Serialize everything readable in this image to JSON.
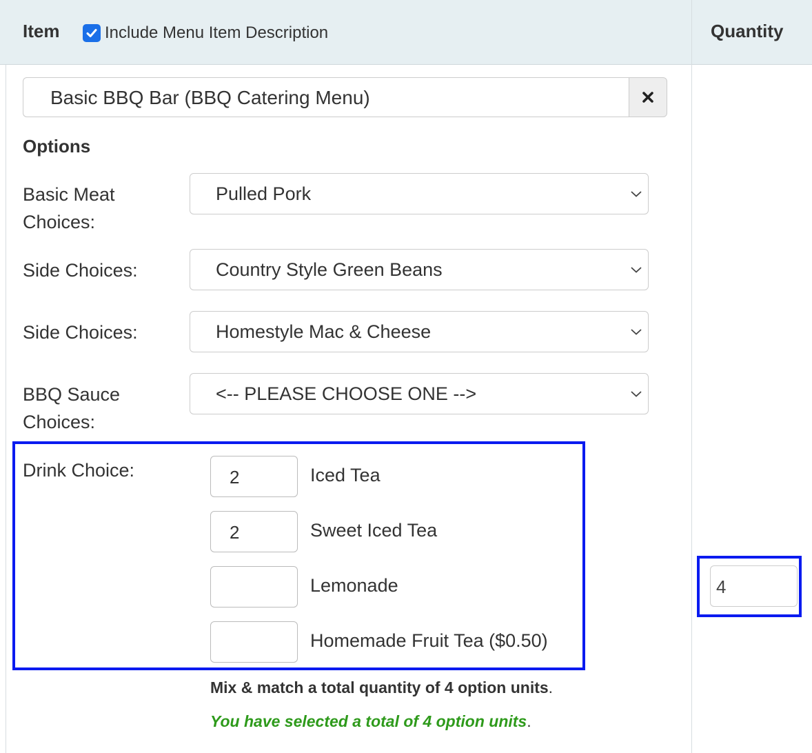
{
  "header": {
    "item_label": "Item",
    "include_description_label": "Include Menu Item Description",
    "include_description_checked": true,
    "quantity_label": "Quantity"
  },
  "item": {
    "selected": "Basic BBQ Bar (BBQ Catering Menu)"
  },
  "options": {
    "heading": "Options",
    "selects": [
      {
        "label": "Basic Meat Choices:",
        "value": "Pulled Pork"
      },
      {
        "label": "Side Choices:",
        "value": "Country Style Green Beans"
      },
      {
        "label": "Side Choices:",
        "value": "Homestyle Mac & Cheese"
      },
      {
        "label": "BBQ Sauce Choices:",
        "value": "<-- PLEASE CHOOSE ONE -->"
      }
    ],
    "drink": {
      "label": "Drink Choice:",
      "items": [
        {
          "qty": "2",
          "name": "Iced Tea"
        },
        {
          "qty": "2",
          "name": "Sweet Iced Tea"
        },
        {
          "qty": "",
          "name": "Lemonade"
        },
        {
          "qty": "",
          "name": "Homemade Fruit Tea ($0.50)"
        }
      ]
    },
    "mix_match_text": "Mix & match a total quantity of 4 option units",
    "selected_total_text": "You have selected a total of 4 option units",
    "period": "."
  },
  "quantity": {
    "value": "4"
  },
  "colors": {
    "header_bg": "#e6eff2",
    "highlight": "#0a1bf0",
    "checkbox": "#1a6fe8",
    "success": "#2e9a1b"
  },
  "icons": {
    "checkbox": "checkmark-icon",
    "clear": "close-icon",
    "select": "chevron-down-icon"
  }
}
